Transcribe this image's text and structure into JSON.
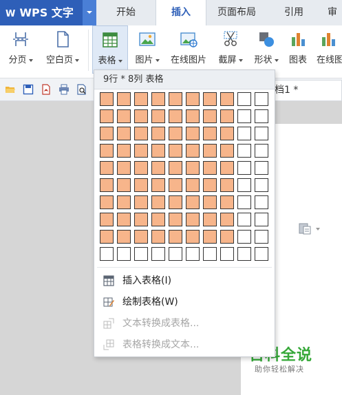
{
  "app": {
    "name": "WPS 文字",
    "logo": "W"
  },
  "tabs": [
    {
      "label": "开始"
    },
    {
      "label": "插入",
      "active": true
    },
    {
      "label": "页面布局"
    },
    {
      "label": "引用"
    },
    {
      "label": "审"
    }
  ],
  "ribbon": {
    "buttons": [
      {
        "label": "分页",
        "icon": "page-break-icon",
        "dropdown": true
      },
      {
        "label": "空白页",
        "icon": "blank-page-icon",
        "dropdown": true
      },
      {
        "label": "表格",
        "icon": "table-icon",
        "dropdown": true,
        "active": true
      },
      {
        "label": "图片",
        "icon": "picture-icon",
        "dropdown": true
      },
      {
        "label": "在线图片",
        "icon": "online-picture-icon",
        "dropdown": false
      },
      {
        "label": "截屏",
        "icon": "screenshot-icon",
        "dropdown": true
      },
      {
        "label": "形状",
        "icon": "shapes-icon",
        "dropdown": true
      },
      {
        "label": "图表",
        "icon": "chart-icon",
        "dropdown": false
      },
      {
        "label": "在线图",
        "icon": "online-chart-icon",
        "dropdown": false
      }
    ]
  },
  "quick_access": {
    "icons": [
      "open-folder-icon",
      "save-icon",
      "export-pdf-icon",
      "print-icon",
      "print-preview-icon"
    ]
  },
  "document": {
    "tab_title": "档1 *"
  },
  "table_dropdown": {
    "header": "9行 * 8列 表格",
    "grid": {
      "rows": 10,
      "cols": 10,
      "selected_rows": 9,
      "selected_cols": 8
    },
    "items": [
      {
        "label": "插入表格(I)",
        "icon": "insert-table-icon",
        "disabled": false
      },
      {
        "label": "绘制表格(W)",
        "icon": "draw-table-icon",
        "disabled": false
      },
      {
        "label": "文本转换成表格...",
        "icon": "text-to-table-icon",
        "disabled": true
      },
      {
        "label": "表格转换成文本...",
        "icon": "table-to-text-icon",
        "disabled": true
      }
    ]
  },
  "watermark": {
    "title": "百科全说",
    "subtitle": "助你轻松解决"
  },
  "colors": {
    "brand_blue": "#2e5fb8",
    "selected_cell": "#f7b58b",
    "watermark_green": "#35a838"
  }
}
